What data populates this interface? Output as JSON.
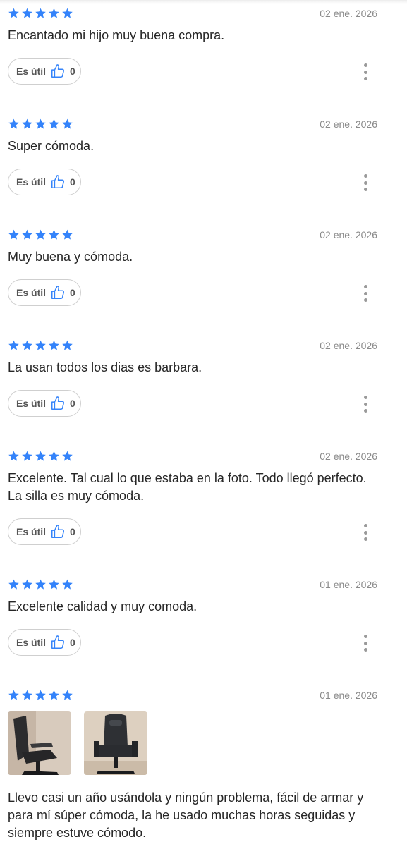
{
  "accent_color": "#3483fa",
  "useful_label": "Es útil",
  "reviews": [
    {
      "rating": 5,
      "date": "02 ene. 2026",
      "text": "Encantado mi hijo muy buena compra.",
      "useful_count": "0"
    },
    {
      "rating": 5,
      "date": "02 ene. 2026",
      "text": "Super cómoda.",
      "useful_count": "0"
    },
    {
      "rating": 5,
      "date": "02 ene. 2026",
      "text": "Muy buena y cómoda.",
      "useful_count": "0"
    },
    {
      "rating": 5,
      "date": "02 ene. 2026",
      "text": "La usan todos los dias es barbara.",
      "useful_count": "0"
    },
    {
      "rating": 5,
      "date": "02 ene. 2026",
      "text": "Excelente. Tal cual lo que estaba en la foto. Todo llegó perfecto. La silla es muy cómoda.",
      "useful_count": "0"
    },
    {
      "rating": 5,
      "date": "01 ene. 2026",
      "text": "Excelente calidad y muy comoda.",
      "useful_count": "0"
    },
    {
      "rating": 5,
      "date": "01 ene. 2026",
      "text": "Llevo casi un año usándola y ningún problema, fácil de armar y para mí súper cómoda, la he usado muchas horas seguidas y siempre estuve cómodo.",
      "photos": [
        "chair-photo-side",
        "chair-photo-front"
      ]
    }
  ]
}
